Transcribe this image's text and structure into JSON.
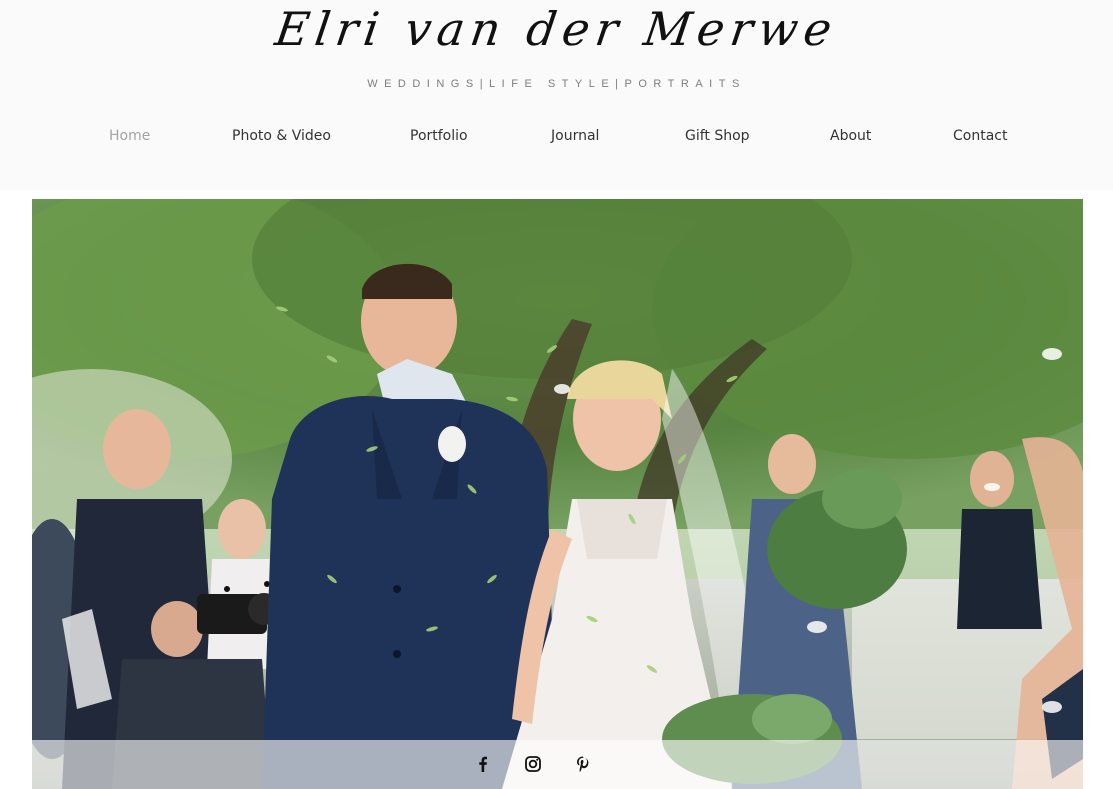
{
  "site": {
    "name": "Elri van der Merwe",
    "tagline": "WEDDINGS|LIFE STYLE|PORTRAITS"
  },
  "nav": {
    "items": [
      {
        "label": "Home",
        "active": true
      },
      {
        "label": "Photo & Video",
        "active": false
      },
      {
        "label": "Portfolio",
        "active": false
      },
      {
        "label": "Journal",
        "active": false
      },
      {
        "label": "Gift Shop",
        "active": false
      },
      {
        "label": "About",
        "active": false
      },
      {
        "label": "Contact",
        "active": false
      }
    ]
  },
  "hero": {
    "social_icons": [
      "facebook-icon",
      "instagram-icon",
      "pinterest-icon"
    ]
  },
  "colors": {
    "nav_active": "#a3a3a3",
    "nav_text": "#333333",
    "tagline": "#7d7d7d",
    "header_bg": "#fafafa"
  }
}
